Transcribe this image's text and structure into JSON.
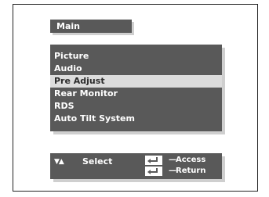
{
  "menu": {
    "title": "Main",
    "items": [
      {
        "label": "Picture"
      },
      {
        "label": "Audio"
      },
      {
        "label": "Pre Adjust",
        "selected": true
      },
      {
        "label": "Rear Monitor"
      },
      {
        "label": "RDS"
      },
      {
        "label": "Auto Tilt System"
      }
    ]
  },
  "footer": {
    "nav_arrows": "▼▲",
    "nav_label": "Select",
    "access_label": "Access",
    "return_label": "Return"
  },
  "colors": {
    "panel": "#595959",
    "selected_row": "#dcdcdc",
    "text": "#ffffff",
    "shadow": "#cfcfcf"
  },
  "icons": {
    "enter_key": "enter-key-icon",
    "updown": "up-down-arrows-icon"
  }
}
